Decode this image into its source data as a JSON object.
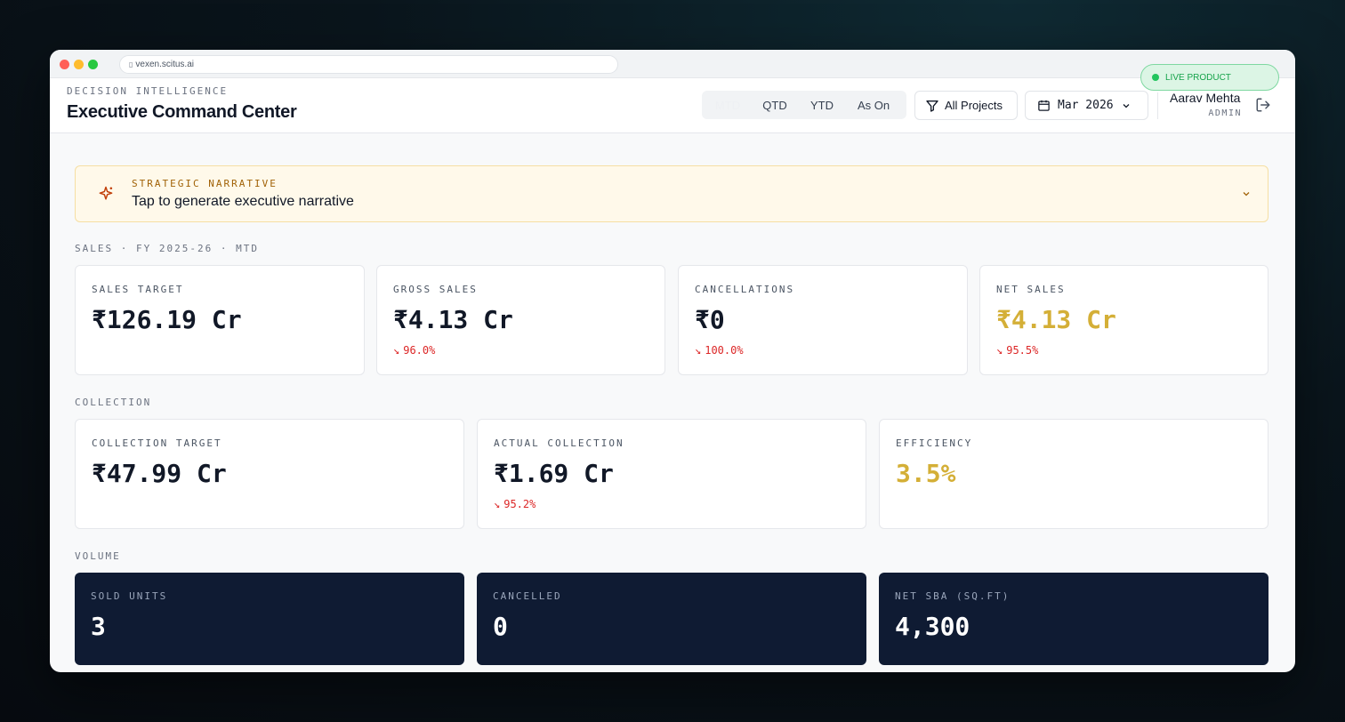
{
  "browser": {
    "url": "vexen.scitus.ai",
    "badge": "LIVE PRODUCT"
  },
  "header": {
    "eyebrow": "DECISION INTELLIGENCE",
    "title": "Executive Command Center",
    "periods": [
      "MTD",
      "QTD",
      "YTD",
      "As On"
    ],
    "active_period": "MTD",
    "filter_label": "All Projects",
    "date_label": "Mar 2026",
    "user_name": "Aarav Mehta",
    "user_role": "ADMIN"
  },
  "narrative": {
    "label": "STRATEGIC NARRATIVE",
    "text": "Tap to generate executive narrative"
  },
  "sales": {
    "section_label": "SALES · FY 2025-26 · MTD",
    "cards": [
      {
        "label": "SALES TARGET",
        "value": "₹126.19 Cr",
        "delta": ""
      },
      {
        "label": "GROSS SALES",
        "value": "₹4.13 Cr",
        "delta": "96.0%"
      },
      {
        "label": "CANCELLATIONS",
        "value": "₹0",
        "delta": "100.0%"
      },
      {
        "label": "NET SALES",
        "value": "₹4.13 Cr",
        "delta": "95.5%"
      }
    ]
  },
  "collection": {
    "section_label": "COLLECTION",
    "cards": [
      {
        "label": "COLLECTION TARGET",
        "value": "₹47.99 Cr",
        "delta": ""
      },
      {
        "label": "ACTUAL COLLECTION",
        "value": "₹1.69 Cr",
        "delta": "95.2%"
      },
      {
        "label": "EFFICIENCY",
        "value": "3.5%",
        "delta": ""
      }
    ]
  },
  "volume": {
    "section_label": "VOLUME",
    "cards": [
      {
        "label": "SOLD UNITS",
        "value": "3"
      },
      {
        "label": "CANCELLED",
        "value": "0"
      },
      {
        "label": "NET SBA (SQ.FT)",
        "value": "4,300"
      }
    ]
  },
  "colors": {
    "accent_gold": "#d4af37",
    "delta_down": "#dc2626",
    "dark_card": "#0f1b33",
    "live_green": "#22c55e"
  }
}
